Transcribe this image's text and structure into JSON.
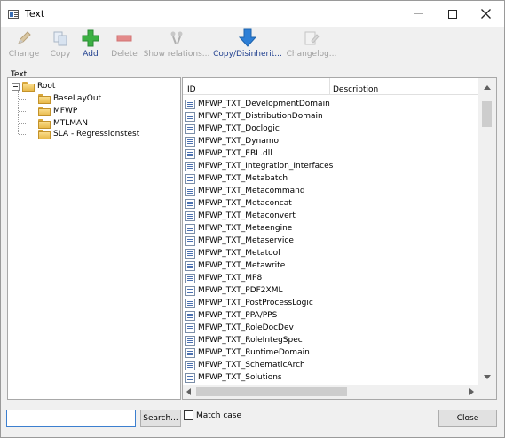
{
  "window": {
    "title": "Text"
  },
  "toolbar": {
    "buttons": [
      {
        "label": "Change",
        "icon": "pencil-icon",
        "enabled": false
      },
      {
        "label": "Copy",
        "icon": "copy-icon",
        "enabled": false
      },
      {
        "label": "Add",
        "icon": "plus-icon",
        "enabled": true,
        "color": "#3cb043"
      },
      {
        "label": "Delete",
        "icon": "minus-icon",
        "enabled": false,
        "color": "#e38a8a"
      },
      {
        "label": "Show relations...",
        "icon": "relations-icon",
        "enabled": false
      },
      {
        "label": "Copy/Disinherit...",
        "icon": "arrow-down-icon",
        "enabled": true,
        "color": "#2d7fd6"
      },
      {
        "label": "Changelog...",
        "icon": "changelog-icon",
        "enabled": false
      }
    ]
  },
  "group_label": "Text",
  "tree": {
    "root": "Root",
    "children": [
      "BaseLayOut",
      "MFWP",
      "MTLMAN",
      "SLA - Regressionstest"
    ]
  },
  "list": {
    "columns": [
      "ID",
      "Description"
    ],
    "rows": [
      "MFWP_TXT_DevelopmentDomain",
      "MFWP_TXT_DistributionDomain",
      "MFWP_TXT_Doclogic",
      "MFWP_TXT_Dynamo",
      "MFWP_TXT_EBL.dll",
      "MFWP_TXT_Integration_Interfaces",
      "MFWP_TXT_Metabatch",
      "MFWP_TXT_Metacommand",
      "MFWP_TXT_Metaconcat",
      "MFWP_TXT_Metaconvert",
      "MFWP_TXT_Metaengine",
      "MFWP_TXT_Metaservice",
      "MFWP_TXT_Metatool",
      "MFWP_TXT_Metawrite",
      "MFWP_TXT_MP8",
      "MFWP_TXT_PDF2XML",
      "MFWP_TXT_PostProcessLogic",
      "MFWP_TXT_PPA/PPS",
      "MFWP_TXT_RoleDocDev",
      "MFWP_TXT_RoleIntegSpec",
      "MFWP_TXT_RuntimeDomain",
      "MFWP_TXT_SchematicArch",
      "MFWP_TXT_Solutions"
    ]
  },
  "bottom": {
    "search_value": "",
    "search_button": "Search...",
    "match_case_label": "Match case",
    "match_case_checked": false,
    "close_button": "Close"
  }
}
